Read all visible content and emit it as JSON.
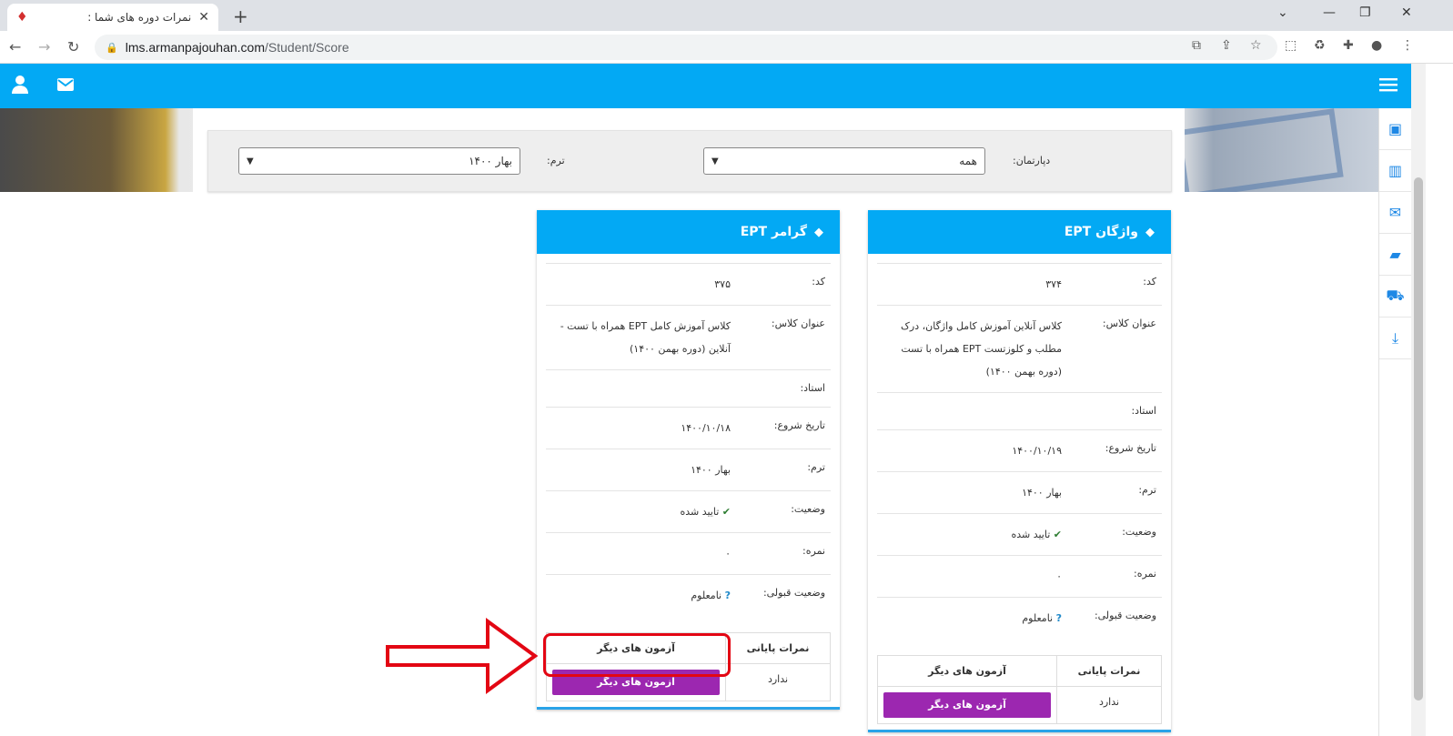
{
  "browser": {
    "tab_title": "نمرات دوره های شما :",
    "url_host": "lms.armanpajouhan.com",
    "url_path": "/Student/Score"
  },
  "filters": {
    "department_label": "دپارتمان:",
    "department_value": "همه",
    "term_label": "ترم:",
    "term_value": "بهار ۱۴۰۰"
  },
  "cards": [
    {
      "title": "واژگان EPT",
      "labels": {
        "code": "کد:",
        "class_title": "عنوان کلاس:",
        "teacher": "استاد:",
        "start": "تاریخ شروع:",
        "term": "ترم:",
        "status": "وضعیت:",
        "score": "نمره:",
        "acceptance": "وضعیت قبولی:"
      },
      "code": "۳۷۴",
      "class_title": "کلاس آنلاین آموزش کامل واژگان، درک مطلب و کلوزتست EPT همراه با تست (دوره بهمن ۱۴۰۰)",
      "teacher": "",
      "start": "۱۴۰۰/۱۰/۱۹",
      "term": "بهار ۱۴۰۰",
      "status": "تایید شده",
      "score": "۰",
      "acceptance": "نامعلوم",
      "table": {
        "col1": "نمرات پایانی",
        "col2": "آزمون های دیگر",
        "final": "ندارد",
        "button": "آزمون های دیگر"
      }
    },
    {
      "title": "گرامر EPT",
      "labels": {
        "code": "کد:",
        "class_title": "عنوان کلاس:",
        "teacher": "استاد:",
        "start": "تاریخ شروع:",
        "term": "ترم:",
        "status": "وضعیت:",
        "score": "نمره:",
        "acceptance": "وضعیت قبولی:"
      },
      "code": "۳۷۵",
      "class_title": "کلاس آموزش کامل EPT همراه با تست - آنلاین (دوره بهمن ۱۴۰۰)",
      "teacher": "",
      "start": "۱۴۰۰/۱۰/۱۸",
      "term": "بهار ۱۴۰۰",
      "status": "تایید شده",
      "score": "۰",
      "acceptance": "نامعلوم",
      "table": {
        "col1": "نمرات پایانی",
        "col2": "آزمون های دیگر",
        "final": "ندارد",
        "button": "آزمون های دیگر"
      }
    }
  ],
  "colors": {
    "appbar": "#03a9f4",
    "button": "#9c27b0",
    "highlight": "#e30613"
  }
}
